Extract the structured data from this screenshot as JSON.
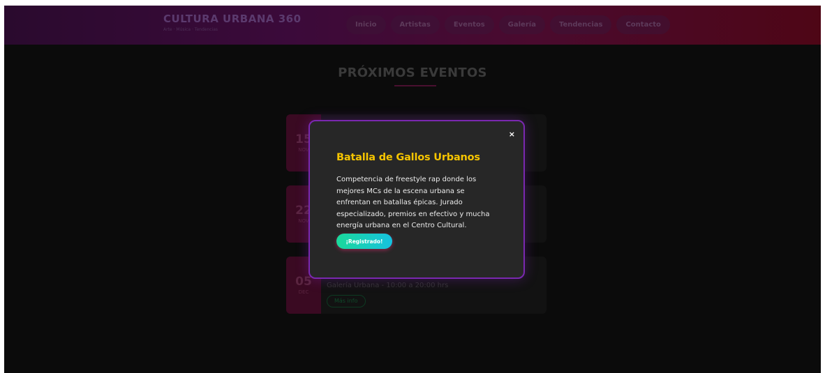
{
  "header": {
    "brand_title": "CULTURA URBANA 360",
    "brand_tagline": "Arte · Música · Tendencias",
    "nav": [
      {
        "label": "Inicio"
      },
      {
        "label": "Artistas"
      },
      {
        "label": "Eventos"
      },
      {
        "label": "Galería"
      },
      {
        "label": "Tendencias"
      },
      {
        "label": "Contacto"
      }
    ]
  },
  "section": {
    "title": "PRÓXIMOS EVENTOS"
  },
  "events": [
    {
      "day": "15",
      "month": "NOV",
      "meta": ""
    },
    {
      "day": "22",
      "month": "NOV",
      "meta": ""
    },
    {
      "day": "05",
      "month": "DEC",
      "meta": "Galería Urbana - 10:00 a 20:00 hrs",
      "more_label": "Más info"
    }
  ],
  "modal": {
    "close_label": "×",
    "title": "Batalla de Gallos Urbanos",
    "description": "Competencia de freestyle rap donde los mejores MCs de la escena urbana se enfrentan en batallas épicas. Jurado especializado, premios en efectivo y mucha energía urbana en el Centro Cultural.",
    "button_label": "¡Registrado!"
  },
  "colors": {
    "modal_title": "#f5c400",
    "modal_border": "#7a28b0",
    "button_gradient_start": "#1bd99a",
    "button_gradient_end": "#16c1e0"
  }
}
